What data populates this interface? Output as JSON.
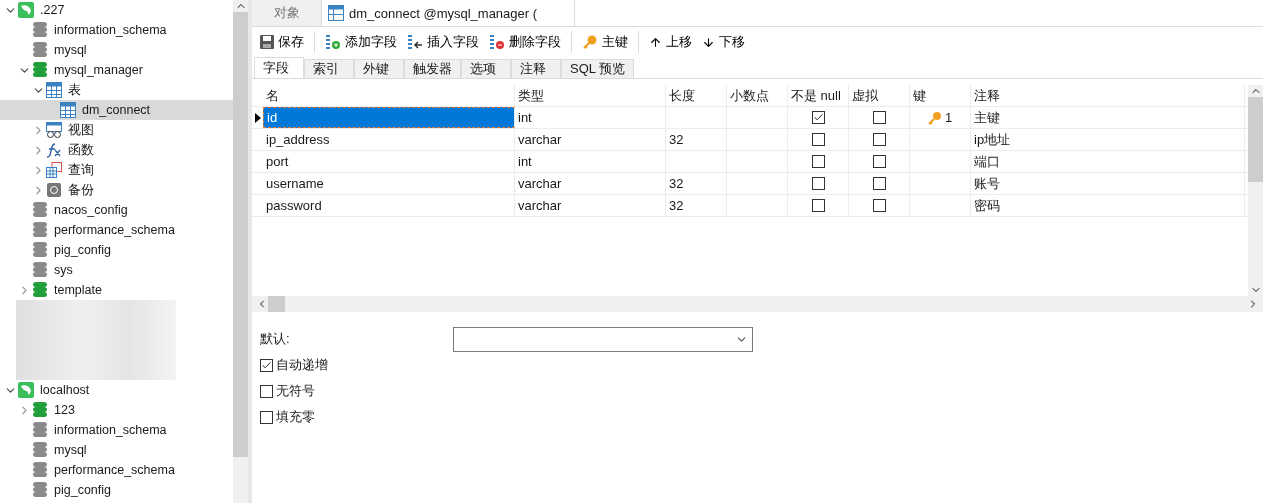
{
  "sidebar": {
    "tree": [
      {
        "kind": "server",
        "label": ".227",
        "expanded": true,
        "selected": false,
        "children": [
          {
            "kind": "database",
            "label": "information_schema",
            "selected": false
          },
          {
            "kind": "database",
            "label": "mysql",
            "selected": false
          },
          {
            "kind": "database-open",
            "label": "mysql_manager",
            "expanded": true,
            "selected": false,
            "children": [
              {
                "kind": "tables",
                "label": "表",
                "expanded": true,
                "selected": false,
                "children": [
                  {
                    "kind": "table",
                    "label": "dm_connect",
                    "selected": true
                  }
                ]
              },
              {
                "kind": "views",
                "label": "视图",
                "expanded": false,
                "selected": false
              },
              {
                "kind": "functions",
                "label": "函数",
                "expanded": false,
                "selected": false
              },
              {
                "kind": "queries",
                "label": "查询",
                "expanded": false,
                "selected": false
              },
              {
                "kind": "backups",
                "label": "备份",
                "expanded": false,
                "selected": false
              }
            ]
          },
          {
            "kind": "database",
            "label": "nacos_config",
            "selected": false
          },
          {
            "kind": "database",
            "label": "performance_schema",
            "selected": false
          },
          {
            "kind": "database",
            "label": "pig_config",
            "selected": false
          },
          {
            "kind": "database",
            "label": "sys",
            "selected": false
          },
          {
            "kind": "database-open",
            "label": "template",
            "expanded": false,
            "selected": false
          }
        ]
      },
      {
        "kind": "redacted"
      },
      {
        "kind": "server",
        "label": "localhost",
        "expanded": true,
        "selected": false,
        "children": [
          {
            "kind": "database-open",
            "label": "123",
            "expanded": false,
            "selected": false
          },
          {
            "kind": "database",
            "label": "information_schema",
            "selected": false
          },
          {
            "kind": "database",
            "label": "mysql",
            "selected": false
          },
          {
            "kind": "database",
            "label": "performance_schema",
            "selected": false
          },
          {
            "kind": "database",
            "label": "pig_config",
            "selected": false
          }
        ]
      }
    ]
  },
  "tabs": [
    {
      "kind": "objects",
      "label": "对象",
      "selected": false
    },
    {
      "kind": "table",
      "label": "dm_connect @mysql_manager (",
      "selected": true
    }
  ],
  "toolbar": [
    [
      {
        "kind": "save",
        "label": "保存"
      }
    ],
    [
      {
        "kind": "add",
        "label": "添加字段"
      },
      {
        "kind": "insert",
        "label": "插入字段"
      },
      {
        "kind": "delete",
        "label": "删除字段"
      }
    ],
    [
      {
        "kind": "key",
        "label": "主键"
      }
    ],
    [
      {
        "kind": "up",
        "label": "上移"
      },
      {
        "kind": "down",
        "label": "下移"
      }
    ]
  ],
  "subtabs": [
    {
      "label": "字段",
      "selected": true
    },
    {
      "label": "索引",
      "selected": false
    },
    {
      "label": "外键",
      "selected": false
    },
    {
      "label": "触发器",
      "selected": false
    },
    {
      "label": "选项",
      "selected": false
    },
    {
      "label": "注释",
      "selected": false
    },
    {
      "label": "SQL 预览",
      "selected": false
    }
  ],
  "table": {
    "columns": [
      "名",
      "类型",
      "长度",
      "小数点",
      "不是 null",
      "虚拟",
      "键",
      "注释"
    ],
    "rows": [
      {
        "name": "id",
        "type": "int",
        "not_null": true,
        "virtual": false,
        "key": "1",
        "comment": "主键",
        "selected": true
      },
      {
        "name": "ip_address",
        "type": "varchar",
        "length": "32",
        "not_null": false,
        "virtual": false,
        "comment": "ip地址",
        "selected": false
      },
      {
        "name": "port",
        "type": "int",
        "not_null": false,
        "virtual": false,
        "comment": "端口",
        "selected": false
      },
      {
        "name": "username",
        "type": "varchar",
        "length": "32",
        "not_null": false,
        "virtual": false,
        "comment": "账号",
        "selected": false
      },
      {
        "name": "password",
        "type": "varchar",
        "length": "32",
        "not_null": false,
        "virtual": false,
        "comment": "密码",
        "selected": false
      }
    ]
  },
  "properties": {
    "default_label": "默认:",
    "options": [
      {
        "label": "自动递增",
        "checked": true
      },
      {
        "label": "无符号",
        "checked": false
      },
      {
        "label": "填充零",
        "checked": false
      }
    ]
  }
}
